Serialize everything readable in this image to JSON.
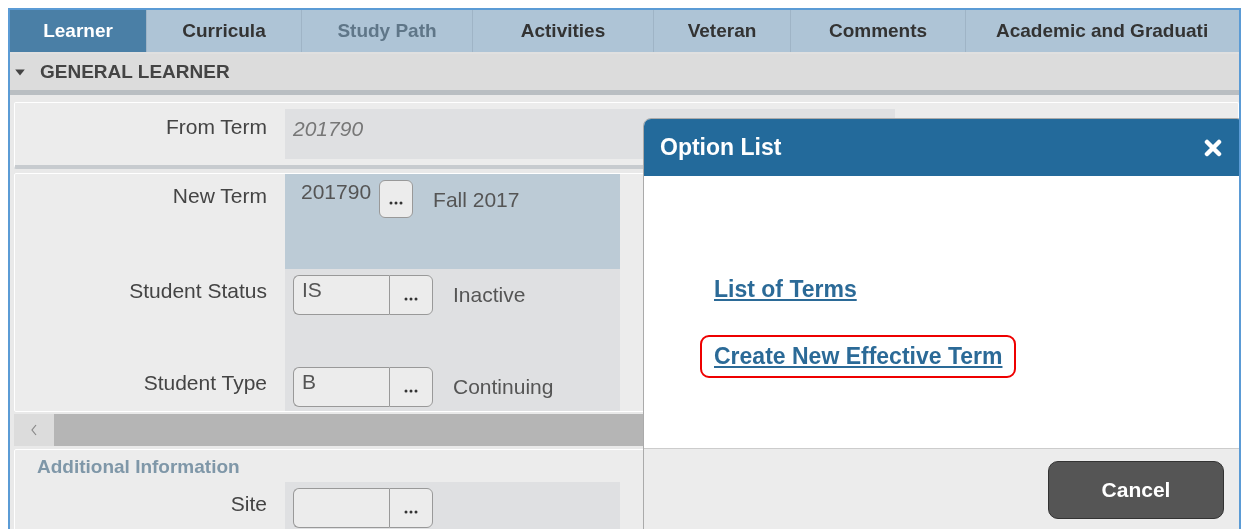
{
  "tabs": [
    {
      "label": "Learner",
      "selected": true,
      "disabled": false
    },
    {
      "label": "Curricula",
      "selected": false,
      "disabled": false
    },
    {
      "label": "Study Path",
      "selected": false,
      "disabled": true
    },
    {
      "label": "Activities",
      "selected": false,
      "disabled": false
    },
    {
      "label": "Veteran",
      "selected": false,
      "disabled": false
    },
    {
      "label": "Comments",
      "selected": false,
      "disabled": false
    },
    {
      "label": "Academic and Graduati",
      "selected": false,
      "disabled": false
    }
  ],
  "section": {
    "title": "GENERAL LEARNER",
    "expanded": true,
    "fields": [
      {
        "kind": "readonly",
        "label": "From Term",
        "value": "201790",
        "focused": false
      },
      {
        "kind": "lookup",
        "label": "New Term",
        "value": "201790",
        "description": "Fall 2017",
        "focused": true
      },
      {
        "kind": "lookup",
        "label": "Student Status",
        "value": "IS",
        "description": "Inactive",
        "focused": false
      },
      {
        "kind": "lookup",
        "label": "Student Type",
        "value": "B",
        "description": "Continuing",
        "focused": false
      }
    ]
  },
  "subsection": {
    "title": "Additional Information",
    "fields": [
      {
        "kind": "lookup",
        "label": "Site",
        "focused": false
      }
    ]
  },
  "dialog": {
    "title": "Option List",
    "options": [
      {
        "label": "List of Terms",
        "highlighted": false
      },
      {
        "label": "Create New Effective Term",
        "highlighted": true
      }
    ],
    "buttons": [
      "Cancel"
    ]
  }
}
